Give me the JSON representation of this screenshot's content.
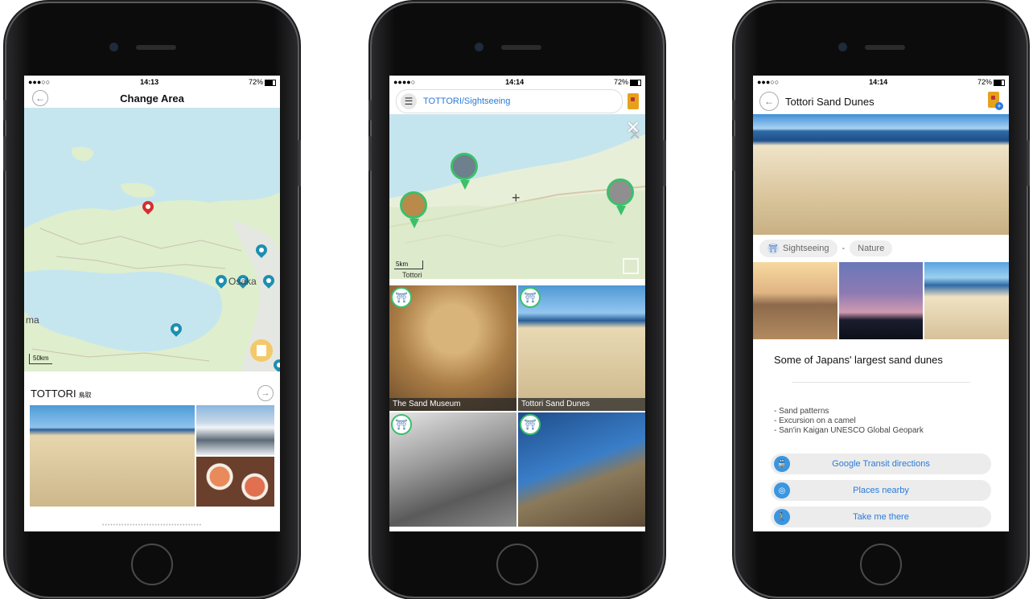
{
  "phone1": {
    "status": {
      "carrier": "●●●○○",
      "time": "14:13",
      "battery": "72%"
    },
    "title": "Change Area",
    "map": {
      "scale": "50km",
      "city": "Osaka",
      "edge_label": "ma"
    },
    "section": {
      "name": "TOTTORI",
      "name_jp": "鳥取"
    },
    "page_dots": "••••••••••••••••••••••••••••••••••••"
  },
  "phone2": {
    "status": {
      "carrier": "●●●●○",
      "time": "14:14",
      "battery": "72%"
    },
    "search": {
      "text": "TOTTORI/Sightseeing"
    },
    "map": {
      "scale": "5km",
      "town": "Tottori"
    },
    "tiles": [
      {
        "caption": "The Sand Museum",
        "color": "#b78f58"
      },
      {
        "caption": "Tottori Sand Dunes",
        "color": "#d9c49a"
      },
      {
        "caption": "",
        "color": "#7b7b7b"
      },
      {
        "caption": "",
        "color": "#2f6aa8"
      }
    ]
  },
  "phone3": {
    "status": {
      "carrier": "●●●○○",
      "time": "14:14",
      "battery": "72%"
    },
    "title": "Tottori Sand Dunes",
    "tags": {
      "category": "Sightseeing",
      "separator": "-",
      "subcategory": "Nature"
    },
    "headline": "Some of Japans' largest sand dunes",
    "bullets": [
      "- Sand patterns",
      "- Excursion on a camel",
      "- San'in Kaigan UNESCO Global Geopark"
    ],
    "actions": [
      {
        "label": "Google Transit directions",
        "icon": "train-icon"
      },
      {
        "label": "Places nearby",
        "icon": "spiral-icon"
      },
      {
        "label": "Take me there",
        "icon": "walk-icon"
      }
    ]
  },
  "colors": {
    "accent": "#2a7bd8",
    "map_green": "#dfeecd",
    "map_water": "#bfe3ee",
    "pin_red": "#d62f2f",
    "pin_teal": "#1c8fb0",
    "badge_green": "#3cbf6a"
  }
}
